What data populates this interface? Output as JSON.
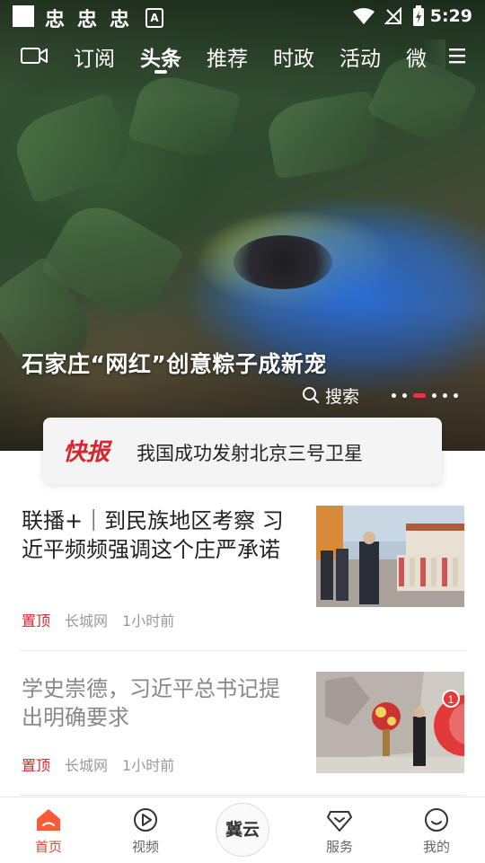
{
  "status_bar": {
    "app_icons": [
      "忠",
      "忠",
      "忠"
    ],
    "time": "5:29"
  },
  "nav": {
    "tabs": [
      "订阅",
      "头条",
      "推荐",
      "时政",
      "活动",
      "微"
    ],
    "active_tab": "头条"
  },
  "hero": {
    "headline": "石家庄“网红”创意粽子成新宠",
    "search_label": "搜索",
    "carousel_total": 6,
    "carousel_active": 3
  },
  "flash": {
    "tag": "快报",
    "text": "我国成功发射北京三号卫星"
  },
  "news": [
    {
      "title": "联播+｜到民族地区考察 习近平频频强调这个庄严承诺",
      "pinned": "置顶",
      "source": "长城网",
      "time": "1小时前",
      "read": false
    },
    {
      "title": "学史崇德，习近平总书记提出明确要求",
      "pinned": "置顶",
      "source": "长城网",
      "time": "1小时前",
      "read": true
    }
  ],
  "thumb2_badge": "1",
  "tabbar": {
    "items": [
      "首页",
      "视频",
      "服务",
      "我的"
    ],
    "center_logo": "冀云",
    "active": "首页"
  },
  "colors": {
    "accent": "#e8432c",
    "flash_red": "#d8262e",
    "carousel_active": "#e8324a"
  }
}
